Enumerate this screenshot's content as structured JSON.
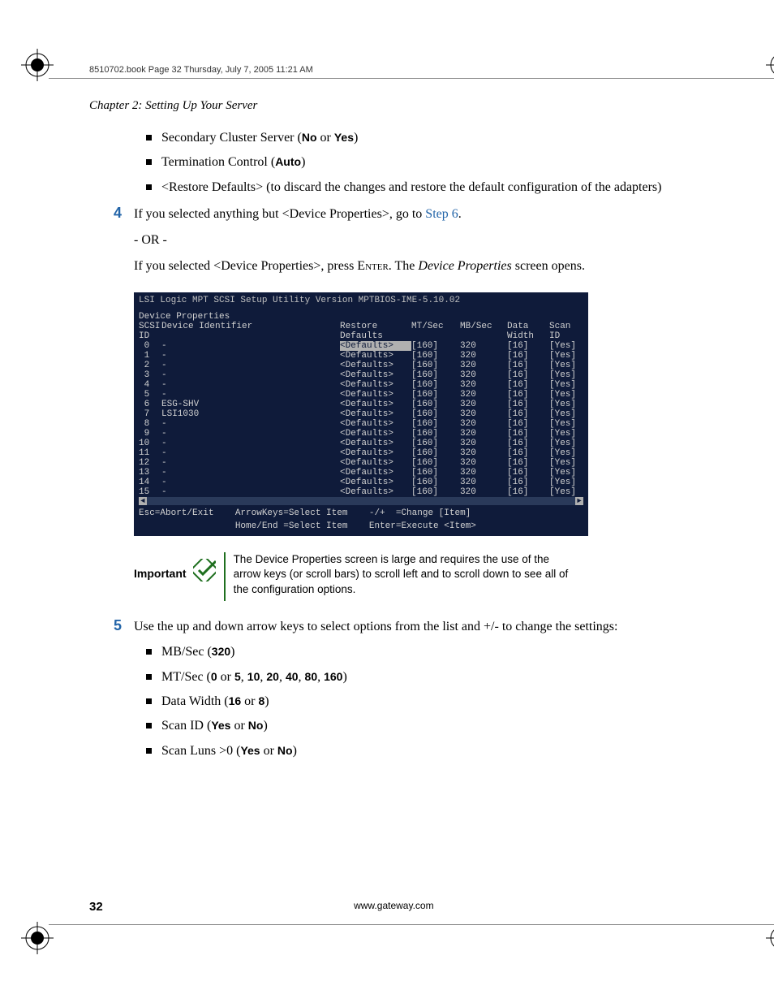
{
  "header": "8510702.book  Page 32  Thursday, July 7, 2005  11:21 AM",
  "chapter": "Chapter 2: Setting Up Your Server",
  "top_bullets": [
    {
      "pre": "Secondary Cluster Server (",
      "bold": "No",
      "mid": " or ",
      "bold2": "Yes",
      "post": ")"
    },
    {
      "pre": "Termination Control (",
      "bold": "Auto",
      "post": ")"
    },
    {
      "pre": "<Restore Defaults> (to discard the changes and restore the default configuration of the adapters)"
    }
  ],
  "step4": {
    "num": "4",
    "line": "If you selected anything but <Device Properties>, go to ",
    "link": "Step 6",
    "after": ".",
    "or": "- OR -",
    "line2a": "If you selected <Device Properties>, press ",
    "enter": "Enter",
    "line2b": ". The ",
    "italic": "Device Properties",
    "line2c": " screen opens."
  },
  "screenshot": {
    "title": "LSI Logic MPT SCSI Setup Utility   Version  MPTBIOS-IME-5.10.02",
    "subtitle": "Device Properties",
    "hdr1": {
      "id": "SCSI",
      "dev": "Device Identifier",
      "def": "Restore",
      "mt": "MT/Sec",
      "mb": "MB/Sec",
      "dw": "Data",
      "si": "Scan"
    },
    "hdr2": {
      "id": "ID",
      "dev": "",
      "def": "Defaults",
      "mt": "",
      "mb": "",
      "dw": "Width",
      "si": "ID"
    },
    "rows": [
      {
        "id": " 0",
        "dev": "-",
        "def": "<Defaults>",
        "mt": "[160]",
        "mb": "320",
        "dw": "[16]",
        "si": "[Yes]",
        "hi": true
      },
      {
        "id": " 1",
        "dev": "-",
        "def": "<Defaults>",
        "mt": "[160]",
        "mb": "320",
        "dw": "[16]",
        "si": "[Yes]"
      },
      {
        "id": " 2",
        "dev": "-",
        "def": "<Defaults>",
        "mt": "[160]",
        "mb": "320",
        "dw": "[16]",
        "si": "[Yes]"
      },
      {
        "id": " 3",
        "dev": "-",
        "def": "<Defaults>",
        "mt": "[160]",
        "mb": "320",
        "dw": "[16]",
        "si": "[Yes]"
      },
      {
        "id": " 4",
        "dev": "-",
        "def": "<Defaults>",
        "mt": "[160]",
        "mb": "320",
        "dw": "[16]",
        "si": "[Yes]"
      },
      {
        "id": " 5",
        "dev": "-",
        "def": "<Defaults>",
        "mt": "[160]",
        "mb": "320",
        "dw": "[16]",
        "si": "[Yes]"
      },
      {
        "id": " 6",
        "dev": "ESG-SHV",
        "def": "<Defaults>",
        "mt": "[160]",
        "mb": "320",
        "dw": "[16]",
        "si": "[Yes]"
      },
      {
        "id": " 7",
        "dev": "LSI1030",
        "def": "<Defaults>",
        "mt": "[160]",
        "mb": "320",
        "dw": "[16]",
        "si": "[Yes]"
      },
      {
        "id": " 8",
        "dev": "-",
        "def": "<Defaults>",
        "mt": "[160]",
        "mb": "320",
        "dw": "[16]",
        "si": "[Yes]"
      },
      {
        "id": " 9",
        "dev": "-",
        "def": "<Defaults>",
        "mt": "[160]",
        "mb": "320",
        "dw": "[16]",
        "si": "[Yes]"
      },
      {
        "id": "10",
        "dev": "-",
        "def": "<Defaults>",
        "mt": "[160]",
        "mb": "320",
        "dw": "[16]",
        "si": "[Yes]"
      },
      {
        "id": "11",
        "dev": "-",
        "def": "<Defaults>",
        "mt": "[160]",
        "mb": "320",
        "dw": "[16]",
        "si": "[Yes]"
      },
      {
        "id": "12",
        "dev": "-",
        "def": "<Defaults>",
        "mt": "[160]",
        "mb": "320",
        "dw": "[16]",
        "si": "[Yes]"
      },
      {
        "id": "13",
        "dev": "-",
        "def": "<Defaults>",
        "mt": "[160]",
        "mb": "320",
        "dw": "[16]",
        "si": "[Yes]"
      },
      {
        "id": "14",
        "dev": "-",
        "def": "<Defaults>",
        "mt": "[160]",
        "mb": "320",
        "dw": "[16]",
        "si": "[Yes]"
      },
      {
        "id": "15",
        "dev": "-",
        "def": "<Defaults>",
        "mt": "[160]",
        "mb": "320",
        "dw": "[16]",
        "si": "[Yes]"
      }
    ],
    "footer1": "Esc=Abort/Exit    ArrowKeys=Select Item    -/+  =Change [Item]",
    "footer2": "                  Home/End =Select Item    Enter=Execute <Item>"
  },
  "important": {
    "label": "Important",
    "text": "The Device Properties screen is large and requires the use of the arrow keys (or scroll bars) to scroll left and to scroll down to see all of the configuration options."
  },
  "step5": {
    "num": "5",
    "text": "Use the up and down arrow keys to select options from the list and +/- to change the settings:"
  },
  "step5_bullets": [
    {
      "pre": "MB/Sec (",
      "bold": "320",
      "post": ")"
    },
    {
      "pre": "MT/Sec (",
      "bold": "0",
      "mid": " or ",
      "bold2": "5",
      "mid2": ", ",
      "bold3": "10",
      "mid3": ", ",
      "bold4": "20",
      "mid4": ", ",
      "bold5": "40",
      "mid5": ", ",
      "bold6": "80",
      "mid6": ", ",
      "bold7": "160",
      "post": ")"
    },
    {
      "pre": "Data Width (",
      "bold": "16",
      "mid": " or ",
      "bold2": "8",
      "post": ")"
    },
    {
      "pre": "Scan ID (",
      "bold": "Yes",
      "mid": " or ",
      "bold2": "No",
      "post": ")"
    },
    {
      "pre": "Scan Luns >0 (",
      "bold": "Yes",
      "mid": " or ",
      "bold2": "No",
      "post": ")"
    }
  ],
  "footer": {
    "page": "32",
    "url": "www.gateway.com"
  }
}
